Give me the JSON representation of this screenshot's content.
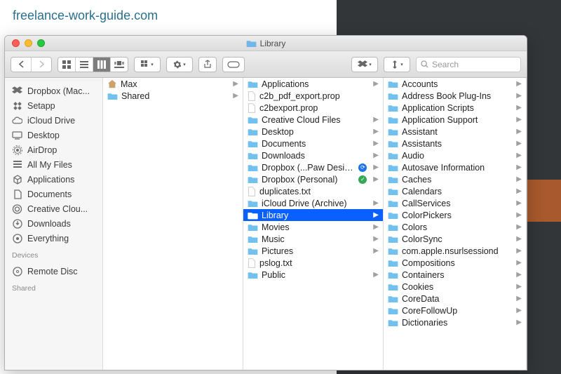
{
  "site_url": "freelance-work-guide.com",
  "window": {
    "title": "Library"
  },
  "toolbar": {
    "search_placeholder": "Search"
  },
  "sidebar": {
    "favorites": [
      {
        "label": "Dropbox (Mac...",
        "icon": "dropbox"
      },
      {
        "label": "Setapp",
        "icon": "setapp"
      },
      {
        "label": "iCloud Drive",
        "icon": "cloud"
      },
      {
        "label": "Desktop",
        "icon": "desktop"
      },
      {
        "label": "AirDrop",
        "icon": "airdrop"
      },
      {
        "label": "All My Files",
        "icon": "allfiles"
      },
      {
        "label": "Applications",
        "icon": "apps"
      },
      {
        "label": "Documents",
        "icon": "docs"
      },
      {
        "label": "Creative Clou...",
        "icon": "cc"
      },
      {
        "label": "Downloads",
        "icon": "downloads"
      },
      {
        "label": "Everything",
        "icon": "smart"
      }
    ],
    "devices_header": "Devices",
    "devices": [
      {
        "label": "Remote Disc",
        "icon": "disc"
      }
    ],
    "shared_header": "Shared"
  },
  "columns": {
    "c1": [
      {
        "name": "Max",
        "type": "home",
        "expandable": true
      },
      {
        "name": "Shared",
        "type": "folder",
        "expandable": true
      }
    ],
    "c2": [
      {
        "name": "Applications",
        "type": "folder",
        "expandable": true
      },
      {
        "name": "c2b_pdf_export.prop",
        "type": "file"
      },
      {
        "name": "c2bexport.prop",
        "type": "file"
      },
      {
        "name": "Creative Cloud Files",
        "type": "folder",
        "expandable": true
      },
      {
        "name": "Desktop",
        "type": "folder",
        "expandable": true
      },
      {
        "name": "Documents",
        "type": "folder",
        "expandable": true
      },
      {
        "name": "Downloads",
        "type": "folder",
        "expandable": true
      },
      {
        "name": "Dropbox (...Paw Design)",
        "type": "folder",
        "expandable": true,
        "badge": "blue"
      },
      {
        "name": "Dropbox (Personal)",
        "type": "folder",
        "expandable": true,
        "badge": "green"
      },
      {
        "name": "duplicates.txt",
        "type": "file"
      },
      {
        "name": "iCloud Drive (Archive)",
        "type": "folder",
        "expandable": true
      },
      {
        "name": "Library",
        "type": "folder",
        "expandable": true,
        "selected": true
      },
      {
        "name": "Movies",
        "type": "folder",
        "expandable": true
      },
      {
        "name": "Music",
        "type": "folder",
        "expandable": true
      },
      {
        "name": "Pictures",
        "type": "folder",
        "expandable": true
      },
      {
        "name": "pslog.txt",
        "type": "file"
      },
      {
        "name": "Public",
        "type": "folder",
        "expandable": true
      }
    ],
    "c3": [
      {
        "name": "Accounts",
        "type": "folder",
        "expandable": true
      },
      {
        "name": "Address Book Plug-Ins",
        "type": "folder",
        "expandable": true
      },
      {
        "name": "Application Scripts",
        "type": "folder",
        "expandable": true
      },
      {
        "name": "Application Support",
        "type": "folder",
        "expandable": true
      },
      {
        "name": "Assistant",
        "type": "folder",
        "expandable": true
      },
      {
        "name": "Assistants",
        "type": "folder",
        "expandable": true
      },
      {
        "name": "Audio",
        "type": "folder",
        "expandable": true
      },
      {
        "name": "Autosave Information",
        "type": "folder",
        "expandable": true
      },
      {
        "name": "Caches",
        "type": "folder",
        "expandable": true
      },
      {
        "name": "Calendars",
        "type": "folder",
        "expandable": true
      },
      {
        "name": "CallServices",
        "type": "folder",
        "expandable": true
      },
      {
        "name": "ColorPickers",
        "type": "folder",
        "expandable": true
      },
      {
        "name": "Colors",
        "type": "folder",
        "expandable": true
      },
      {
        "name": "ColorSync",
        "type": "folder",
        "expandable": true
      },
      {
        "name": "com.apple.nsurlsessiond",
        "type": "folder",
        "expandable": true
      },
      {
        "name": "Compositions",
        "type": "folder",
        "expandable": true
      },
      {
        "name": "Containers",
        "type": "folder",
        "expandable": true
      },
      {
        "name": "Cookies",
        "type": "folder",
        "expandable": true
      },
      {
        "name": "CoreData",
        "type": "folder",
        "expandable": true
      },
      {
        "name": "CoreFollowUp",
        "type": "folder",
        "expandable": true
      },
      {
        "name": "Dictionaries",
        "type": "folder",
        "expandable": true
      }
    ]
  }
}
